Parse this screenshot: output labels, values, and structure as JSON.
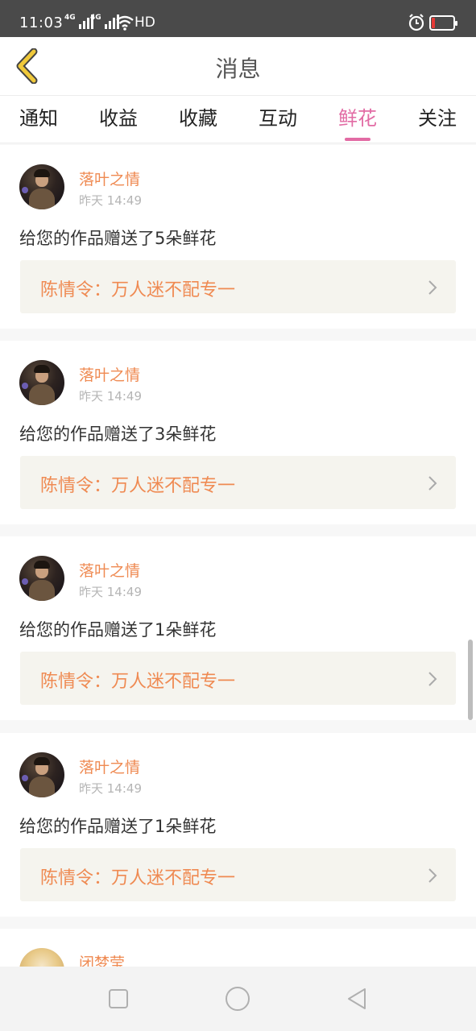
{
  "status_bar": {
    "time": "11:03",
    "network1": "4G",
    "network2": "4G",
    "hd": "HD",
    "battery_color": "#e53935"
  },
  "header": {
    "title": "消息",
    "back_icon": "chevron-left-icon",
    "back_color": "#f0c93a"
  },
  "tabs": [
    {
      "label": "通知",
      "active": false
    },
    {
      "label": "收益",
      "active": false
    },
    {
      "label": "收藏",
      "active": false
    },
    {
      "label": "互动",
      "active": false
    },
    {
      "label": "鲜花",
      "active": true
    },
    {
      "label": "关注",
      "active": false
    }
  ],
  "accent_color": "#e26ba4",
  "name_color": "#ef8a52",
  "messages": [
    {
      "username": "落叶之情",
      "time": "昨天 14:49",
      "text": "给您的作品赠送了5朵鲜花",
      "work": "陈情令：万人迷不配专一"
    },
    {
      "username": "落叶之情",
      "time": "昨天 14:49",
      "text": "给您的作品赠送了3朵鲜花",
      "work": "陈情令：万人迷不配专一"
    },
    {
      "username": "落叶之情",
      "time": "昨天 14:49",
      "text": "给您的作品赠送了1朵鲜花",
      "work": "陈情令：万人迷不配专一"
    },
    {
      "username": "落叶之情",
      "time": "昨天 14:49",
      "text": "给您的作品赠送了1朵鲜花",
      "work": "陈情令：万人迷不配专一"
    }
  ],
  "partial_message": {
    "username": "闭梦莹"
  },
  "nav": {
    "recents_icon": "square-icon",
    "home_icon": "circle-icon",
    "back_icon": "triangle-back-icon"
  }
}
